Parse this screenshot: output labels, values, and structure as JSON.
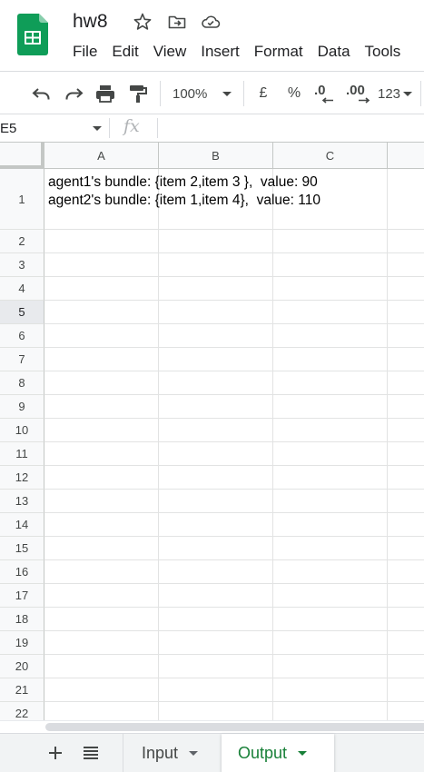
{
  "header": {
    "title": "hw8",
    "menu": [
      "File",
      "Edit",
      "View",
      "Insert",
      "Format",
      "Data",
      "Tools"
    ]
  },
  "toolbar": {
    "zoom": "100%",
    "currency": "£",
    "percent": "%",
    "decrease_decimals": ".0",
    "increase_decimals": ".00",
    "more_formats": "123"
  },
  "formula_bar": {
    "cell_ref": "E5",
    "fx_label": "fx"
  },
  "grid": {
    "columns": [
      "A",
      "B",
      "C"
    ],
    "rows": [
      "1",
      "2",
      "3",
      "4",
      "5",
      "6",
      "7",
      "8",
      "9",
      "10",
      "11",
      "12",
      "13",
      "14",
      "15",
      "16",
      "17",
      "18",
      "19",
      "20",
      "21",
      "22"
    ],
    "selected_row": "5",
    "cell_a1": "agent1's bundle: {item 2,item 3 },  value: 90\nagent2's bundle: {item 1,item 4},  value: 110"
  },
  "sheets": {
    "tabs": [
      "Input",
      "Output"
    ],
    "active": "Output"
  },
  "colors": {
    "brand_green": "#0f9d58",
    "active_tab_text": "#188038",
    "grid_line": "#e2e3e3",
    "header_bg": "#f8f9fa"
  }
}
